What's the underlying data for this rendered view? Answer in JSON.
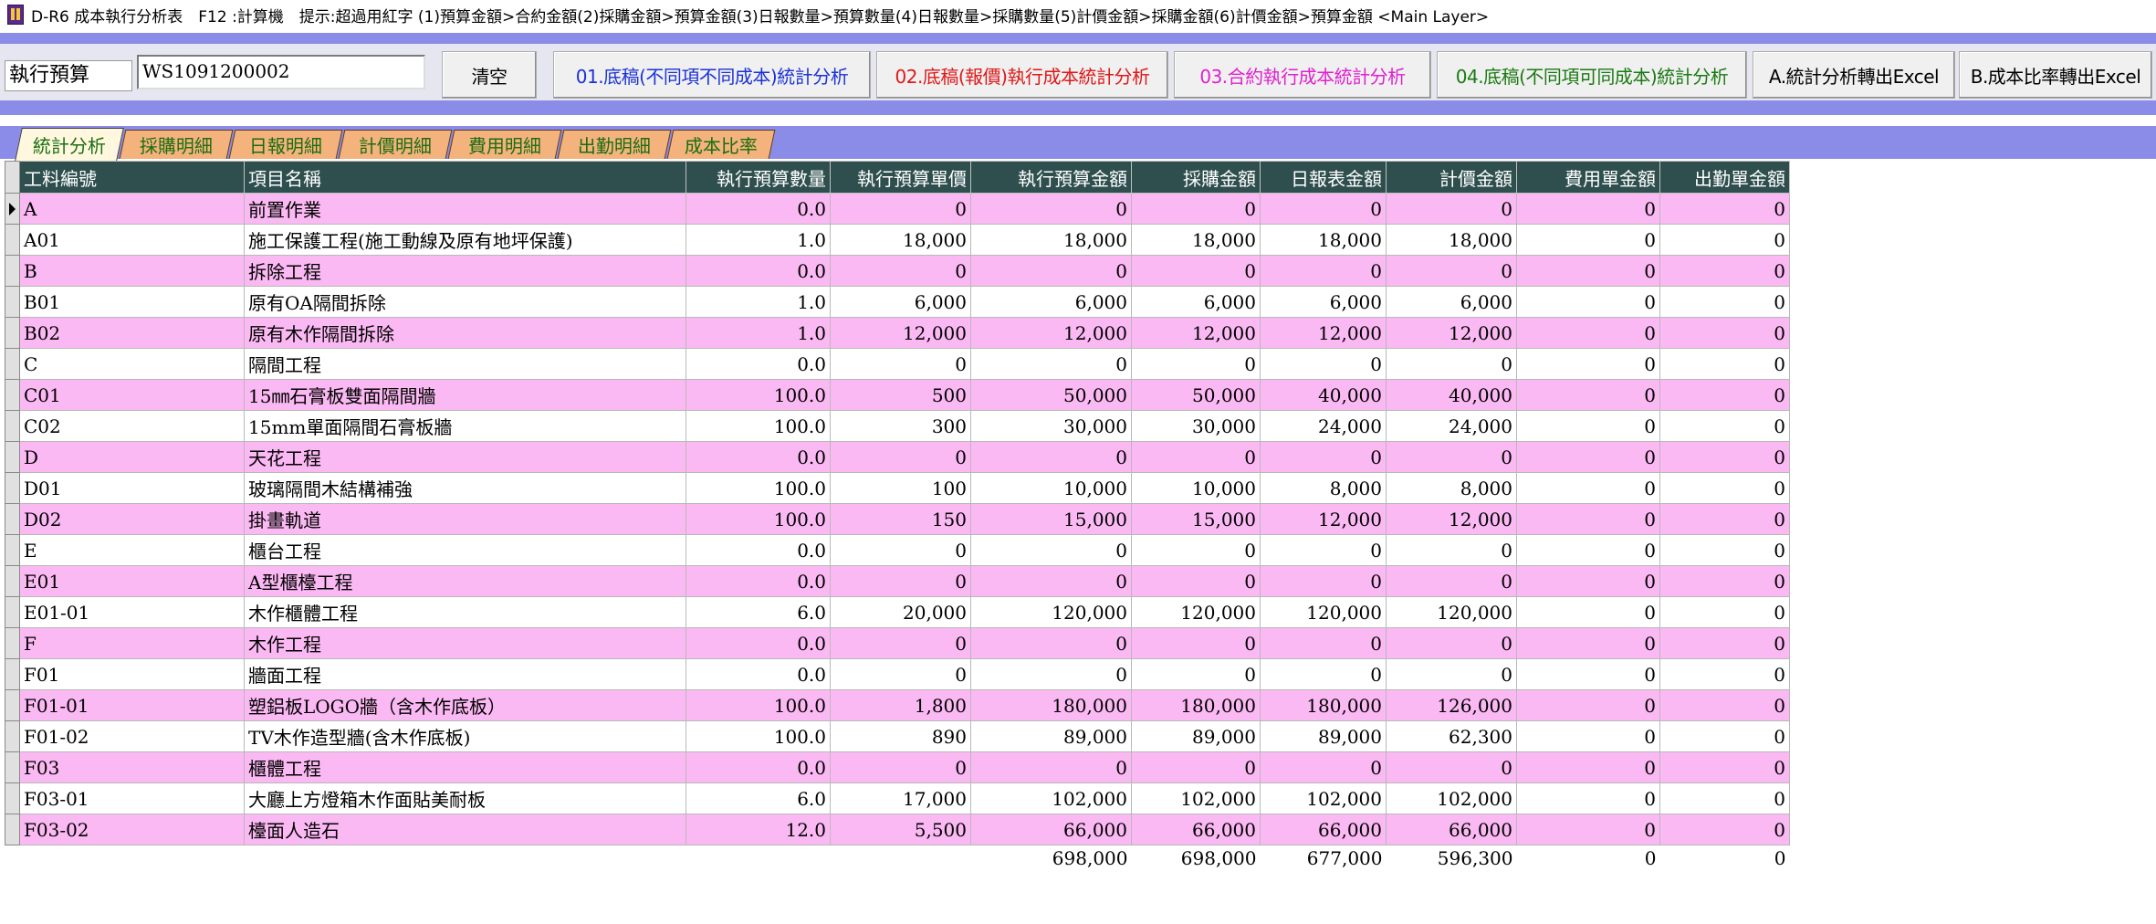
{
  "title": "D-R6 成本執行分析表　F12 :計算機　提示:超過用紅字 (1)預算金額>合約金額(2)採購金額>預算金額(3)日報數量>預算數量(4)日報數量>採購數量(5)計價金額>採購金額(6)計價金額>預算金額 <Main Layer>",
  "toolbar": {
    "field_label": "執行預算",
    "field_value": "WS1091200002",
    "clear_label": "清空",
    "btn1_label": "01.底稿(不同項不同成本)統計分析",
    "btn2_label": "02.底稿(報價)執行成本統計分析",
    "btn3_label": "03.合約執行成本統計分析",
    "btn4_label": "04.底稿(不同項可同成本)統計分析",
    "btnA_label": "A.統計分析轉出Excel",
    "btnB_label": "B.成本比率轉出Excel",
    "btn1_color": "#1a32d8",
    "btn2_color": "#e01818",
    "btn3_color": "#e020d0",
    "btn4_color": "#1a7a12",
    "btn_default_color": "#000000"
  },
  "tabs": [
    "統計分析",
    "採購明細",
    "日報明細",
    "計價明細",
    "費用明細",
    "出勤明細",
    "成本比率"
  ],
  "table": {
    "headers": [
      "工料編號",
      "項目名稱",
      "執行預算數量",
      "執行預算單價",
      "執行預算金額",
      "採購金額",
      "日報表金額",
      "計價金額",
      "費用單金額",
      "出勤單金額"
    ],
    "rows": [
      [
        "A",
        "前置作業",
        "0.0",
        "0",
        "0",
        "0",
        "0",
        "0",
        "0",
        "0"
      ],
      [
        "A01",
        "施工保護工程(施工動線及原有地坪保護)",
        "1.0",
        "18,000",
        "18,000",
        "18,000",
        "18,000",
        "18,000",
        "0",
        "0"
      ],
      [
        "B",
        "拆除工程",
        "0.0",
        "0",
        "0",
        "0",
        "0",
        "0",
        "0",
        "0"
      ],
      [
        "B01",
        "原有OA隔間拆除",
        "1.0",
        "6,000",
        "6,000",
        "6,000",
        "6,000",
        "6,000",
        "0",
        "0"
      ],
      [
        "B02",
        "原有木作隔間拆除",
        "1.0",
        "12,000",
        "12,000",
        "12,000",
        "12,000",
        "12,000",
        "0",
        "0"
      ],
      [
        "C",
        "隔間工程",
        "0.0",
        "0",
        "0",
        "0",
        "0",
        "0",
        "0",
        "0"
      ],
      [
        "C01",
        "15㎜石膏板雙面隔間牆",
        "100.0",
        "500",
        "50,000",
        "50,000",
        "40,000",
        "40,000",
        "0",
        "0"
      ],
      [
        "C02",
        "15mm單面隔間石膏板牆",
        "100.0",
        "300",
        "30,000",
        "30,000",
        "24,000",
        "24,000",
        "0",
        "0"
      ],
      [
        "D",
        "天花工程",
        "0.0",
        "0",
        "0",
        "0",
        "0",
        "0",
        "0",
        "0"
      ],
      [
        "D01",
        "玻璃隔間木結構補強",
        "100.0",
        "100",
        "10,000",
        "10,000",
        "8,000",
        "8,000",
        "0",
        "0"
      ],
      [
        "D02",
        "掛畫軌道",
        "100.0",
        "150",
        "15,000",
        "15,000",
        "12,000",
        "12,000",
        "0",
        "0"
      ],
      [
        "E",
        "櫃台工程",
        "0.0",
        "0",
        "0",
        "0",
        "0",
        "0",
        "0",
        "0"
      ],
      [
        "E01",
        "A型櫃檯工程",
        "0.0",
        "0",
        "0",
        "0",
        "0",
        "0",
        "0",
        "0"
      ],
      [
        "E01-01",
        "木作櫃體工程",
        "6.0",
        "20,000",
        "120,000",
        "120,000",
        "120,000",
        "120,000",
        "0",
        "0"
      ],
      [
        "F",
        "木作工程",
        "0.0",
        "0",
        "0",
        "0",
        "0",
        "0",
        "0",
        "0"
      ],
      [
        "F01",
        "牆面工程",
        "0.0",
        "0",
        "0",
        "0",
        "0",
        "0",
        "0",
        "0"
      ],
      [
        "F01-01",
        "塑鋁板LOGO牆（含木作底板）",
        "100.0",
        "1,800",
        "180,000",
        "180,000",
        "180,000",
        "126,000",
        "0",
        "0"
      ],
      [
        "F01-02",
        "TV木作造型牆(含木作底板)",
        "100.0",
        "890",
        "89,000",
        "89,000",
        "89,000",
        "62,300",
        "0",
        "0"
      ],
      [
        "F03",
        "櫃體工程",
        "0.0",
        "0",
        "0",
        "0",
        "0",
        "0",
        "0",
        "0"
      ],
      [
        "F03-01",
        "大廳上方燈箱木作面貼美耐板",
        "6.0",
        "17,000",
        "102,000",
        "102,000",
        "102,000",
        "102,000",
        "0",
        "0"
      ],
      [
        "F03-02",
        "檯面人造石",
        "12.0",
        "5,500",
        "66,000",
        "66,000",
        "66,000",
        "66,000",
        "0",
        "0"
      ]
    ],
    "totals": [
      "",
      "",
      "",
      "",
      "698,000",
      "698,000",
      "677,000",
      "596,300",
      "0",
      "0"
    ]
  },
  "colors": {
    "band": "#8b8be8",
    "header_bg": "#2f4f4f",
    "row_pink": "#fbb9f3",
    "row_white": "#ffffff",
    "tab_bg": "#f4b27c",
    "tab_text": "#1a6e12"
  }
}
